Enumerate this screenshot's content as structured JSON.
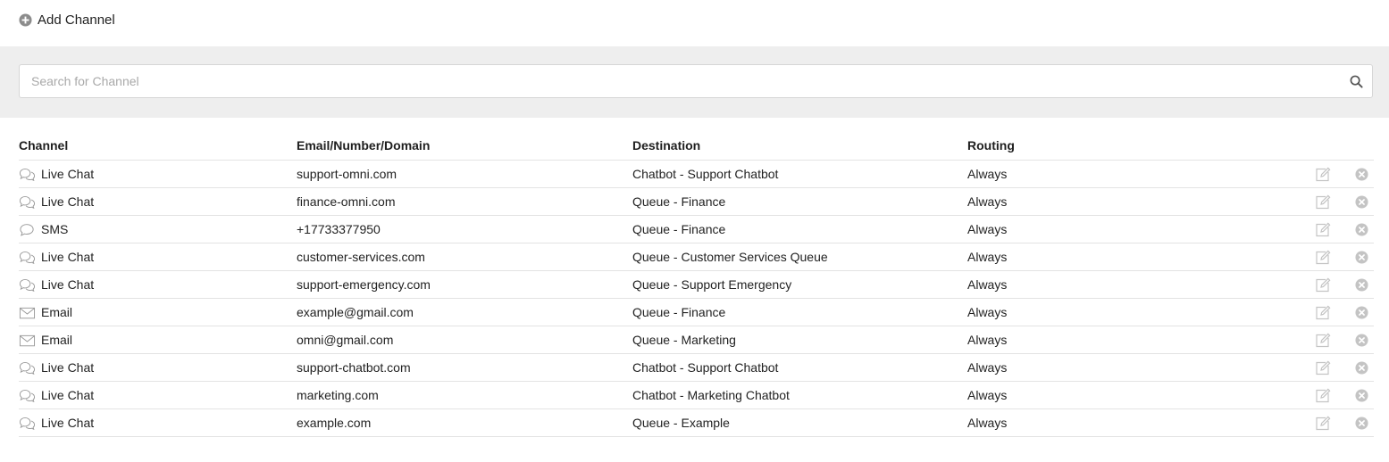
{
  "toolbar": {
    "add_channel_label": "Add Channel"
  },
  "search": {
    "placeholder": "Search for Channel",
    "value": ""
  },
  "table": {
    "headers": {
      "channel": "Channel",
      "contact": "Email/Number/Domain",
      "destination": "Destination",
      "routing": "Routing"
    },
    "rows": [
      {
        "icon": "chat-bubbles-icon",
        "channel": "Live Chat",
        "contact": "support-omni.com",
        "destination": "Chatbot - Support Chatbot",
        "routing": "Always"
      },
      {
        "icon": "chat-bubbles-icon",
        "channel": "Live Chat",
        "contact": "finance-omni.com",
        "destination": "Queue - Finance",
        "routing": "Always"
      },
      {
        "icon": "sms-bubble-icon",
        "channel": "SMS",
        "contact": "+17733377950",
        "destination": "Queue - Finance",
        "routing": "Always"
      },
      {
        "icon": "chat-bubbles-icon",
        "channel": "Live Chat",
        "contact": "customer-services.com",
        "destination": "Queue - Customer Services Queue",
        "routing": "Always"
      },
      {
        "icon": "chat-bubbles-icon",
        "channel": "Live Chat",
        "contact": "support-emergency.com",
        "destination": "Queue - Support Emergency",
        "routing": "Always"
      },
      {
        "icon": "envelope-icon",
        "channel": "Email",
        "contact": "example@gmail.com",
        "destination": "Queue - Finance",
        "routing": "Always"
      },
      {
        "icon": "envelope-icon",
        "channel": "Email",
        "contact": "omni@gmail.com",
        "destination": "Queue - Marketing",
        "routing": "Always"
      },
      {
        "icon": "chat-bubbles-icon",
        "channel": "Live Chat",
        "contact": "support-chatbot.com",
        "destination": "Chatbot - Support Chatbot",
        "routing": "Always"
      },
      {
        "icon": "chat-bubbles-icon",
        "channel": "Live Chat",
        "contact": "marketing.com",
        "destination": "Chatbot - Marketing Chatbot",
        "routing": "Always"
      },
      {
        "icon": "chat-bubbles-icon",
        "channel": "Live Chat",
        "contact": "example.com",
        "destination": "Queue - Example",
        "routing": "Always"
      }
    ]
  },
  "colors": {
    "band": "#eeeeee",
    "icon_gray": "#8c8c8c",
    "action_icon": "#c4c4c4",
    "divider": "#e3e3e3"
  }
}
